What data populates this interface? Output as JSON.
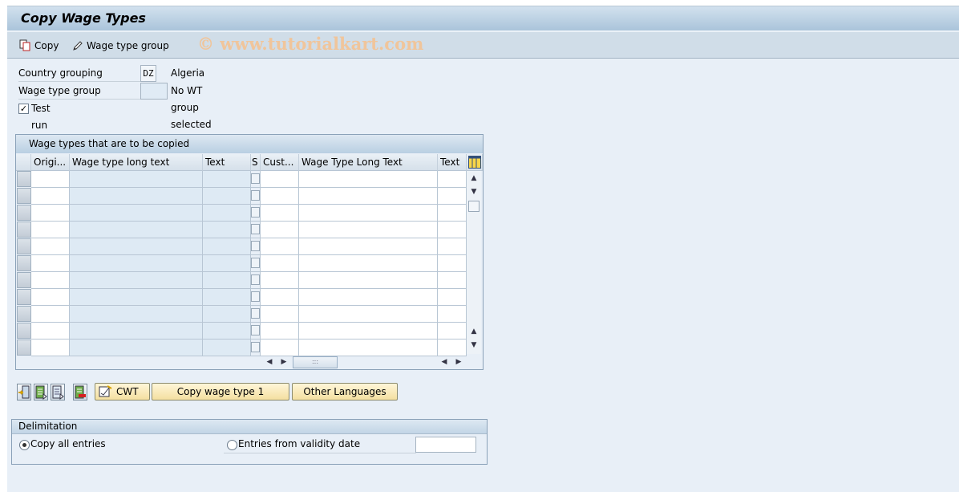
{
  "window": {
    "title": "Copy Wage Types"
  },
  "toolbar": {
    "copy_label": "Copy",
    "wage_type_group_label": "Wage type group",
    "watermark": "© www.tutorialkart.com"
  },
  "form": {
    "country_grouping": {
      "label": "Country grouping",
      "value": "DZ",
      "description": "Algeria"
    },
    "wage_type_group": {
      "label": "Wage type group",
      "value": "",
      "description": "No WT group selected"
    },
    "test_run": {
      "label": "Test run",
      "checked": true,
      "mark": "✓"
    }
  },
  "grid": {
    "title": "Wage types that are to be copied",
    "columns": [
      {
        "key": "orig",
        "label": "Origi..."
      },
      {
        "key": "long_text",
        "label": "Wage type long text"
      },
      {
        "key": "text",
        "label": "Text"
      },
      {
        "key": "s",
        "label": "S"
      },
      {
        "key": "cust",
        "label": "Cust..."
      },
      {
        "key": "cust_long_text",
        "label": "Wage Type Long Text"
      },
      {
        "key": "cust_text",
        "label": "Text"
      }
    ],
    "row_count": 11,
    "rows": []
  },
  "actions": {
    "cwt_label": "CWT",
    "copy_wage_type_label": "Copy wage type 1",
    "other_languages_label": "Other Languages"
  },
  "delimitation": {
    "title": "Delimitation",
    "options": [
      {
        "label": "Copy all entries",
        "selected": true
      },
      {
        "label": "Entries from validity date",
        "selected": false
      }
    ],
    "validity_date": ""
  }
}
